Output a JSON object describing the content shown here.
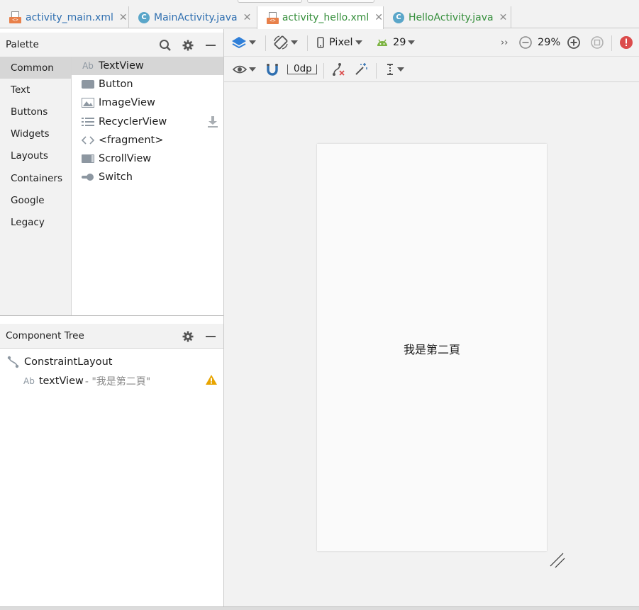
{
  "tabs": [
    {
      "label": "activity_main.xml",
      "icon": "xml-file-icon",
      "color": "#2f6fb0",
      "active": false
    },
    {
      "label": "MainActivity.java",
      "icon": "java-class-icon",
      "color": "#2f6fb0",
      "active": false
    },
    {
      "label": "activity_hello.xml",
      "icon": "xml-file-icon",
      "color": "#368f3c",
      "active": true
    },
    {
      "label": "HelloActivity.java",
      "icon": "java-class-icon",
      "color": "#368f3c",
      "active": false
    }
  ],
  "tab_close_glyph": "✕",
  "palette": {
    "title": "Palette",
    "categories": [
      "Common",
      "Text",
      "Buttons",
      "Widgets",
      "Layouts",
      "Containers",
      "Google",
      "Legacy"
    ],
    "selected_category": "Common",
    "items": [
      {
        "label": "TextView",
        "icon": "textview-icon"
      },
      {
        "label": "Button",
        "icon": "button-icon"
      },
      {
        "label": "ImageView",
        "icon": "image-icon"
      },
      {
        "label": "RecyclerView",
        "icon": "list-icon"
      },
      {
        "label": "<fragment>",
        "icon": "code-icon"
      },
      {
        "label": "ScrollView",
        "icon": "scrollview-icon"
      },
      {
        "label": "Switch",
        "icon": "switch-icon"
      }
    ]
  },
  "component_tree": {
    "title": "Component Tree",
    "root": "ConstraintLayout",
    "child_name": "textView",
    "child_text": "- \"我是第二頁\""
  },
  "toolbar": {
    "device": "Pixel",
    "api": "29",
    "zoom": "29%",
    "margin": "0dp",
    "overflow": "››"
  },
  "preview": {
    "text": "我是第二頁"
  },
  "colors": {
    "warning": "#e8a400",
    "error": "#db4b4b",
    "layers": "#2f7fd8",
    "android": "#7cb342"
  }
}
